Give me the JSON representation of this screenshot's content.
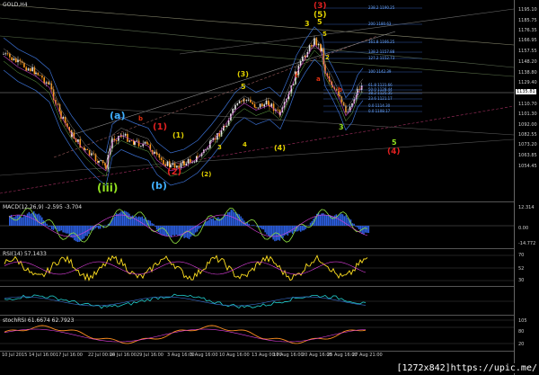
{
  "symbol": "GOLD,H4",
  "watermark": "[1272x842]https://upic.me/",
  "main": {
    "price_labels": [
      "1195.10",
      "1185.75",
      "1176.35",
      "1166.95",
      "1157.55",
      "1148.20",
      "1138.80",
      "1129.40",
      "1120.05",
      "1110.70",
      "1101.30",
      "1092.00",
      "1082.55",
      "1073.20",
      "1063.85",
      "1054.45"
    ],
    "current_price": "1135.81",
    "fib_levels": [
      {
        "text": "238.2 1190.25"
      },
      {
        "text": "200 1180.63"
      },
      {
        "text": "161.8 1166.25"
      },
      {
        "text": "138.2 1157.88"
      },
      {
        "text": "127.2 1152.73"
      },
      {
        "text": "100 1142.39"
      },
      {
        "text": "61.8 1131.66"
      },
      {
        "text": "50.0 1128.44"
      },
      {
        "text": "38.2 1125.35"
      },
      {
        "text": "23.6 1121.17"
      },
      {
        "text": "0.0 1114.30"
      },
      {
        "text": "0.0 1108.17"
      }
    ],
    "wave_labels": [
      {
        "text": "(3)",
        "color": "#e02020"
      },
      {
        "text": "3",
        "color": "#e0d000"
      },
      {
        "text": "5",
        "color": "#e0d000"
      },
      {
        "text": "(5)",
        "color": "#e0d000"
      },
      {
        "text": "5",
        "color": "#e0d000"
      },
      {
        "text": "2",
        "color": "#e0d000"
      },
      {
        "text": "b",
        "color": "#e03010"
      },
      {
        "text": "a",
        "color": "#e03010"
      },
      {
        "text": "c",
        "color": "#e03010"
      },
      {
        "text": "3",
        "color": "#90e020"
      },
      {
        "text": "5",
        "color": "#90e020"
      },
      {
        "text": "(4)",
        "color": "#e02020"
      },
      {
        "text": "(3)",
        "color": "#e0d000"
      },
      {
        "text": "5",
        "color": "#e0d000"
      },
      {
        "text": "(4)",
        "color": "#e0d000"
      },
      {
        "text": "(1)",
        "color": "#e02020"
      },
      {
        "text": "(2)",
        "color": "#e02020"
      },
      {
        "text": "(a)",
        "color": "#40b0ff"
      },
      {
        "text": "(b)",
        "color": "#40b0ff"
      },
      {
        "text": "(iii)",
        "color": "#90e020"
      },
      {
        "text": "b",
        "color": "#e03010"
      },
      {
        "text": "(1)",
        "color": "#e0d000"
      },
      {
        "text": "(2)",
        "color": "#e0d000"
      },
      {
        "text": "4",
        "color": "#e0d000"
      },
      {
        "text": "3",
        "color": "#e0d000"
      }
    ]
  },
  "indicators": {
    "macd": {
      "label": "MACD(12,26,9) -2.595 -3.704",
      "levels": [
        "12.314",
        "0.00",
        "-14.772"
      ]
    },
    "rsi": {
      "label": "RSI(14) 57.1433",
      "levels": [
        "70",
        "52",
        "30"
      ]
    },
    "cci": {
      "label": "",
      "levels": [
        "",
        ""
      ]
    },
    "stoch": {
      "label": "stochRSI 61.6674 62.7923",
      "levels": [
        "105",
        "80",
        "20"
      ]
    }
  },
  "time_labels": [
    "10 Jul 2015",
    "14 Jul 16:00",
    "17 Jul 16:00",
    "22 Jul 00:00",
    "24 Jul 16:00",
    "29 Jul 16:00",
    "3 Aug 16:00",
    "5 Aug 16:00",
    "10 Aug 16:00",
    "13 Aug 00:00",
    "17 Aug 16:00",
    "20 Aug 16:00",
    "25 Aug 16:00",
    "27 Aug 21:00"
  ]
}
